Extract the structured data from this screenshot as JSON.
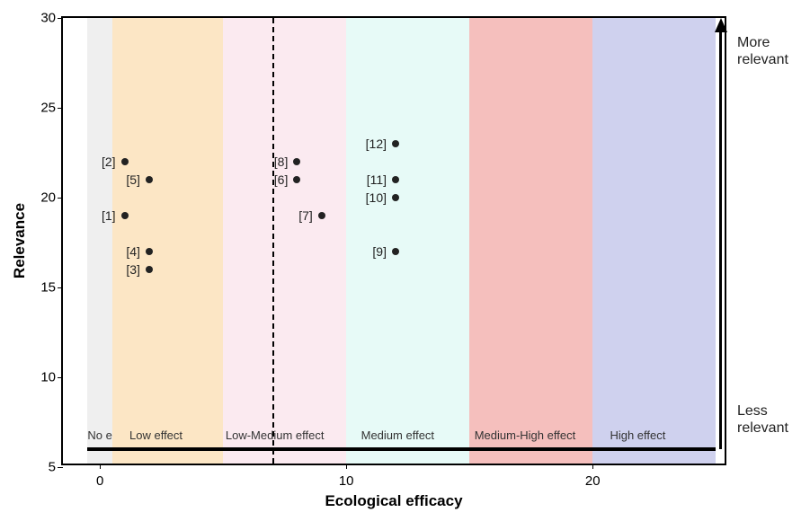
{
  "chart_data": {
    "type": "scatter",
    "xlabel": "Ecological efficacy",
    "ylabel": "Relevance",
    "xlim": [
      -1.5,
      25.5
    ],
    "ylim": [
      5,
      30
    ],
    "x_ticks": [
      0,
      10,
      20
    ],
    "y_ticks": [
      5,
      10,
      15,
      20,
      25,
      30
    ],
    "bands": [
      {
        "label": "No effect",
        "x0": -0.5,
        "x1": 0.5,
        "color": "#EFEFEF"
      },
      {
        "label": "Low effect",
        "x0": 0.5,
        "x1": 5.0,
        "color": "#FCE6C5"
      },
      {
        "label": "Low-Medium effect",
        "x0": 5.0,
        "x1": 10.0,
        "color": "#FBEAF0"
      },
      {
        "label": "Medium effect",
        "x0": 10.0,
        "x1": 15.0,
        "color": "#E7FAF7"
      },
      {
        "label": "Medium-High effect",
        "x0": 15.0,
        "x1": 20.0,
        "color": "#F5BFBD"
      },
      {
        "label": "High effect",
        "x0": 20.0,
        "x1": 25.0,
        "color": "#CFD1EE"
      }
    ],
    "band_label_x": [
      -0.5,
      1.2,
      5.1,
      10.6,
      15.2,
      20.7
    ],
    "vrule_x": 7.0,
    "baseline_y": 6.0,
    "baseline_x": [
      -0.5,
      25.0
    ],
    "points": [
      {
        "id": "[1]",
        "x": 1,
        "y": 19
      },
      {
        "id": "[2]",
        "x": 1,
        "y": 22
      },
      {
        "id": "[3]",
        "x": 2,
        "y": 16
      },
      {
        "id": "[4]",
        "x": 2,
        "y": 17
      },
      {
        "id": "[5]",
        "x": 2,
        "y": 21
      },
      {
        "id": "[6]",
        "x": 8,
        "y": 21
      },
      {
        "id": "[7]",
        "x": 9,
        "y": 19
      },
      {
        "id": "[8]",
        "x": 8,
        "y": 22
      },
      {
        "id": "[9]",
        "x": 12,
        "y": 17
      },
      {
        "id": "[10]",
        "x": 12,
        "y": 20
      },
      {
        "id": "[11]",
        "x": 12,
        "y": 21
      },
      {
        "id": "[12]",
        "x": 12,
        "y": 23
      }
    ],
    "side_annotations": {
      "top": "More\nrelevant",
      "bottom": "Less\nrelevant"
    },
    "arrow": {
      "y0": 6,
      "y1": 30,
      "x": 25.2
    }
  }
}
